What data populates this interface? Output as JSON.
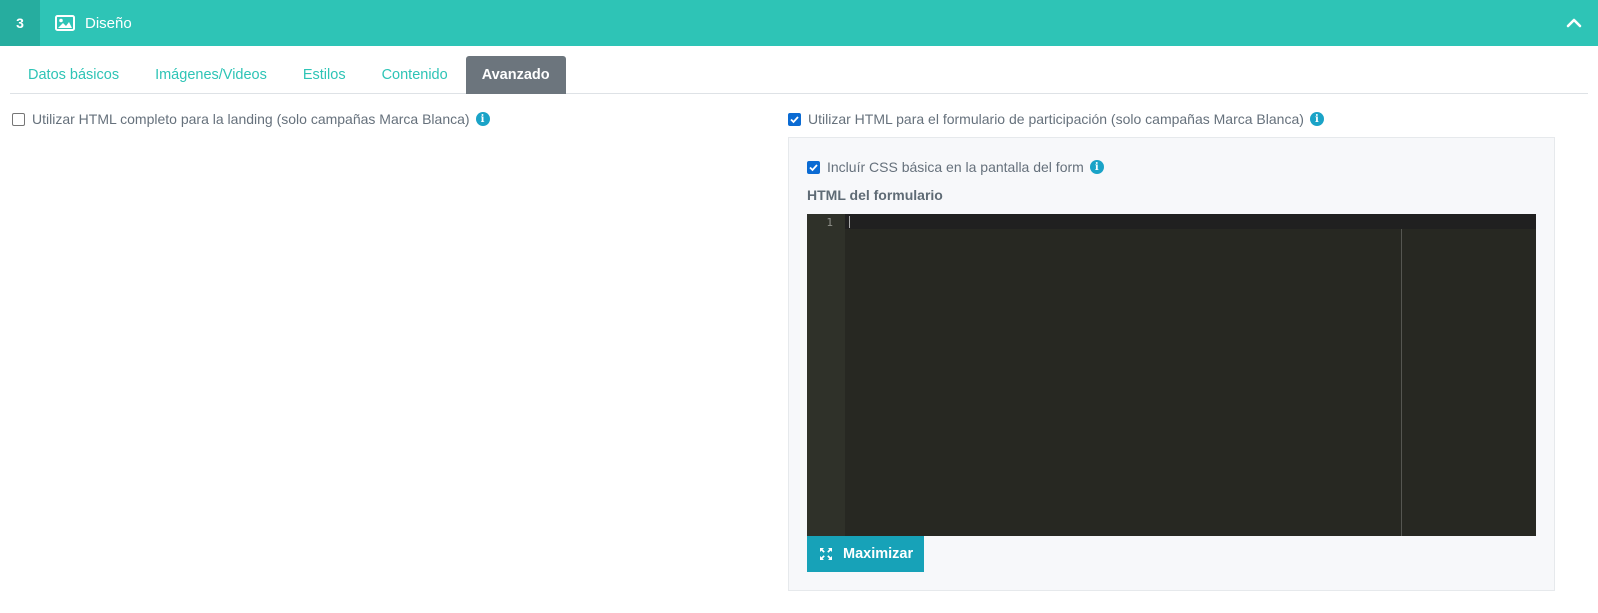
{
  "header": {
    "step_number": "3",
    "title": "Diseño",
    "icon": "image-icon",
    "collapse_icon": "chevron-up-icon"
  },
  "tabs": [
    {
      "label": "Datos básicos",
      "active": false
    },
    {
      "label": "Imágenes/Videos",
      "active": false
    },
    {
      "label": "Estilos",
      "active": false
    },
    {
      "label": "Contenido",
      "active": false
    },
    {
      "label": "Avanzado",
      "active": true
    }
  ],
  "options": {
    "full_html_landing": {
      "label": "Utilizar HTML completo para la landing (solo campañas Marca Blanca)",
      "checked": false
    },
    "html_form": {
      "label": "Utilizar HTML para el formulario de participación (solo campañas Marca Blanca)",
      "checked": true
    },
    "basic_css": {
      "label": "Incluír CSS básica en la pantalla del form",
      "checked": true
    }
  },
  "editor": {
    "label": "HTML del formulario",
    "line_number": "1",
    "content": ""
  },
  "maximize_button": {
    "label": "Maximizar",
    "icon": "expand-icon"
  },
  "colors": {
    "header": "#2ec4b6",
    "tab_active": "#6c757d",
    "button": "#17a2b8",
    "info": "#1aa3c7",
    "editor_bg": "#272822"
  }
}
